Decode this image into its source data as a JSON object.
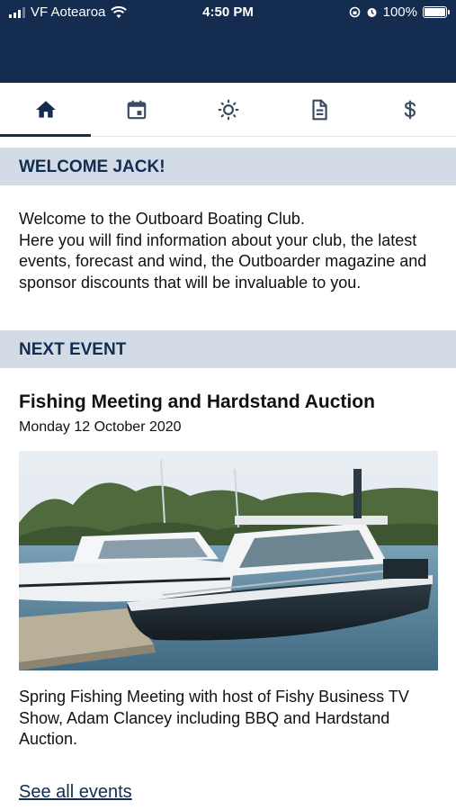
{
  "status_bar": {
    "carrier": "VF Aotearoa",
    "time": "4:50 PM",
    "battery": "100%"
  },
  "tabs": [
    {
      "icon": "home-icon",
      "active": true
    },
    {
      "icon": "calendar-icon",
      "active": false
    },
    {
      "icon": "weather-icon",
      "active": false
    },
    {
      "icon": "document-icon",
      "active": false
    },
    {
      "icon": "dollar-icon",
      "active": false
    }
  ],
  "welcome": {
    "header": "WELCOME JACK!",
    "line1": "Welcome to the Outboard Boating Club.",
    "line2": "Here you will find information about your club, the latest events, forecast and wind, the Outboarder magazine and sponsor discounts that will be invaluable to you."
  },
  "next_event": {
    "header": "NEXT EVENT",
    "title": "Fishing Meeting and Hardstand Auction",
    "date": "Monday 12 October 2020",
    "description": "Spring Fishing Meeting with host of Fishy Business TV Show, Adam Clancey including BBQ and Hardstand Auction.",
    "link": "See all events"
  },
  "colors": {
    "navy": "#132c4f",
    "section_bg": "#d2dbe6"
  }
}
